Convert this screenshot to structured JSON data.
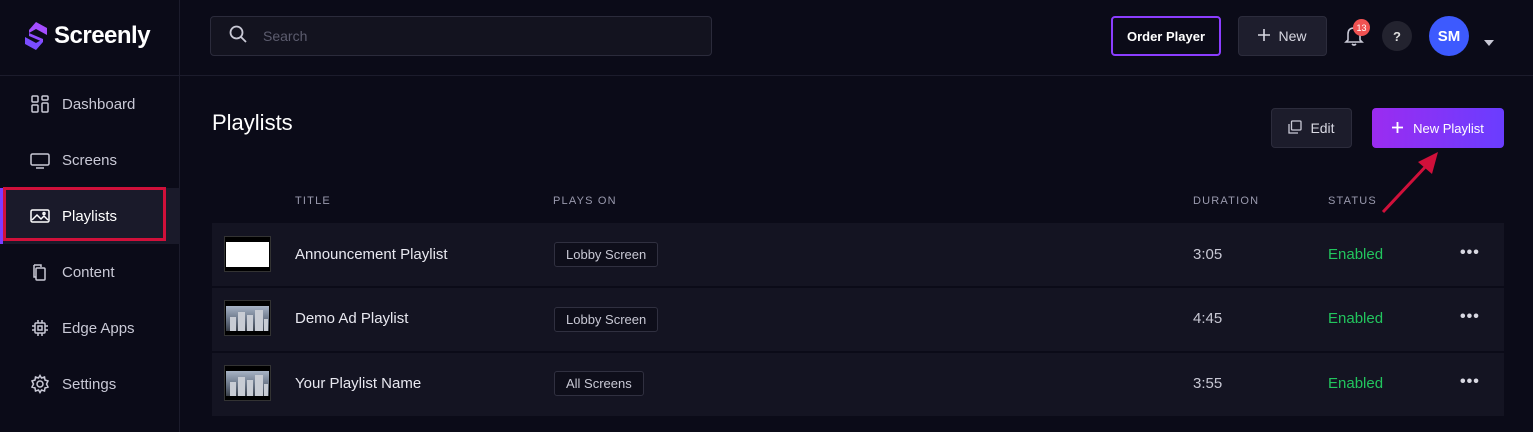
{
  "app": {
    "name": "Screenly"
  },
  "sidebar": {
    "items": [
      {
        "label": "Dashboard",
        "icon": "dashboard-icon"
      },
      {
        "label": "Screens",
        "icon": "screen-icon"
      },
      {
        "label": "Playlists",
        "icon": "image-icon",
        "active": true
      },
      {
        "label": "Content",
        "icon": "files-icon"
      },
      {
        "label": "Edge Apps",
        "icon": "chip-icon"
      },
      {
        "label": "Settings",
        "icon": "gear-icon"
      }
    ]
  },
  "header": {
    "search_placeholder": "Search",
    "order_label": "Order Player",
    "new_label": "New",
    "notification_count": "13",
    "help_label": "?",
    "avatar_initials": "SM"
  },
  "main": {
    "title": "Playlists",
    "edit_label": "Edit",
    "new_playlist_label": "New Playlist",
    "columns": {
      "title": "TITLE",
      "plays_on": "PLAYS ON",
      "duration": "DURATION",
      "status": "STATUS"
    },
    "rows": [
      {
        "title": "Announcement Playlist",
        "plays_on": "Lobby Screen",
        "duration": "3:05",
        "status": "Enabled",
        "thumb": "blank"
      },
      {
        "title": "Demo Ad Playlist",
        "plays_on": "Lobby Screen",
        "duration": "4:45",
        "status": "Enabled",
        "thumb": "city"
      },
      {
        "title": "Your Playlist Name",
        "plays_on": "All Screens",
        "duration": "3:55",
        "status": "Enabled",
        "thumb": "city"
      }
    ],
    "more_label": "•••"
  },
  "colors": {
    "accent": "#8b3dff",
    "status_enabled": "#22c55e",
    "highlight": "#d0103a",
    "avatar": "#3d5afe"
  }
}
